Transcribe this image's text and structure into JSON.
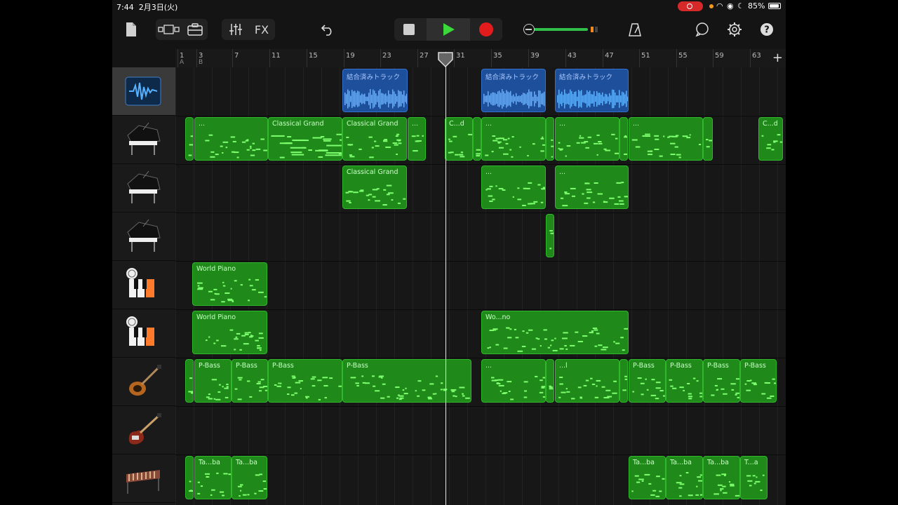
{
  "status_bar": {
    "time": "7:44",
    "date": "2月3日(火)",
    "battery": "85%"
  },
  "toolbar": {
    "fx_label": "FX"
  },
  "ruler": {
    "bars": [
      "1",
      "3",
      "7",
      "11",
      "15",
      "19",
      "23",
      "27",
      "31",
      "35",
      "39",
      "43",
      "47",
      "51",
      "55",
      "59",
      "63"
    ],
    "sections": [
      "A",
      "B"
    ],
    "add_label": "+"
  },
  "tracks": [
    {
      "icon": "audio-waveform-icon",
      "selected": true
    },
    {
      "icon": "grand-piano-icon"
    },
    {
      "icon": "grand-piano-icon"
    },
    {
      "icon": "grand-piano-icon"
    },
    {
      "icon": "world-piano-icon"
    },
    {
      "icon": "world-piano-icon"
    },
    {
      "icon": "violin-bass-icon"
    },
    {
      "icon": "electric-bass-icon"
    },
    {
      "icon": "marimba-icon"
    }
  ],
  "regions": {
    "r0": [
      "結合済みトラック",
      "結合済みトラック",
      "結合済みトラック"
    ],
    "r1": [
      "...",
      "Classical Grand",
      "Classical Grand",
      "...",
      "C...d",
      "...",
      "...",
      "...",
      "C...d"
    ],
    "r2": [
      "Classical Grand",
      "...",
      "..."
    ],
    "r4": [
      "World Piano"
    ],
    "r5": [
      "World Piano",
      "Wo...no"
    ],
    "r6": [
      "P-Bass",
      "P-Bass",
      "P-Bass",
      "P-Bass",
      "...",
      "...l",
      "P-Bass",
      "P-Bass",
      "P-Bass",
      "P-Bass"
    ],
    "r8": [
      "Ta...ba",
      "Ta...ba",
      "Ta...ba",
      "Ta...ba",
      "Ta...ba",
      "T...a"
    ]
  },
  "colors": {
    "midi_region": "#1f8a1a",
    "audio_region": "#1e4f9a",
    "play": "#3ad83a",
    "record": "#e21c1c"
  }
}
